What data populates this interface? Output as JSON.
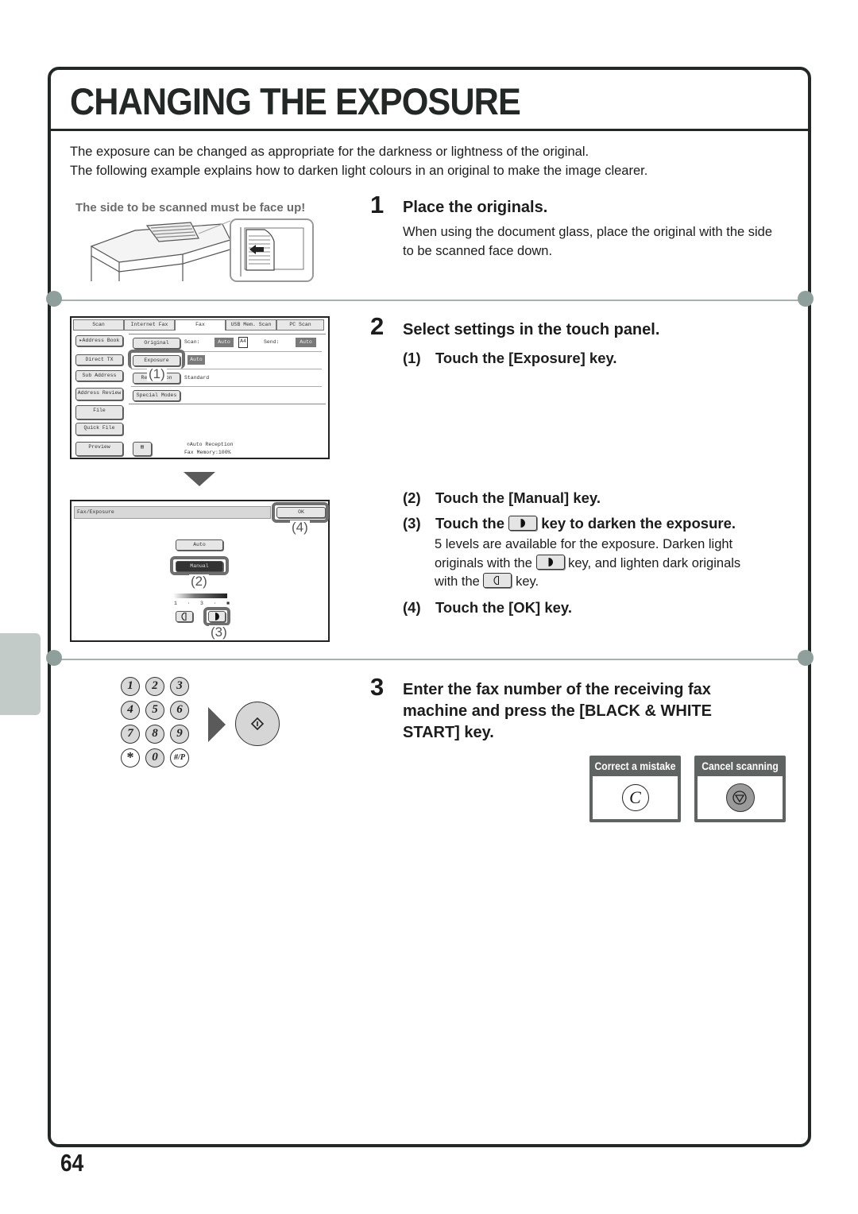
{
  "page": {
    "title": "CHANGING THE EXPOSURE",
    "intro_lines": [
      "The exposure can be changed as appropriate for the darkness or lightness of the original.",
      "The following example explains how to darken light colours in an original to make the image clearer."
    ],
    "page_number": "64"
  },
  "illustration_1": {
    "caption": "The side to be scanned must be face up!"
  },
  "steps": [
    {
      "number": "1",
      "title": "Place the originals.",
      "body": "When using the document glass, place the original with the side to be scanned face down."
    },
    {
      "number": "2",
      "title": "Select settings in the touch panel.",
      "substeps": [
        {
          "number": "(1)",
          "text": "Touch the [Exposure] key."
        },
        {
          "number": "(2)",
          "text": "Touch the [Manual] key."
        },
        {
          "number": "(3)",
          "text_before": "Touch the",
          "text_after": "key to darken the exposure.",
          "icon": "darker-key-icon",
          "note_line1": "5 levels are available for the exposure. Darken light",
          "note_line2_before": "originals with the",
          "note_line2_after": "key, and lighten dark originals",
          "note_line3_before": "with the",
          "note_line3_after": "key."
        },
        {
          "number": "(4)",
          "text": "Touch the [OK] key."
        }
      ]
    },
    {
      "number": "3",
      "title_lines": [
        "Enter the fax number of the receiving fax",
        "machine and press the [BLACK & WHITE",
        "START] key."
      ]
    }
  ],
  "touch_panel_1": {
    "tabs": [
      "Scan",
      "Internet Fax",
      "Fax",
      "USB Mem. Scan",
      "PC Scan"
    ],
    "active_tab": "Fax",
    "left_buttons": [
      "Address Book",
      "Direct TX",
      "Sub Address",
      "Address Review",
      "File",
      "Quick File",
      "Preview"
    ],
    "rows": {
      "original_label": "Original",
      "scan_label": "Scan:",
      "scan_value": "Auto",
      "paper_size": "A4",
      "send_label": "Send:",
      "send_value": "Auto",
      "exposure_label": "Exposure",
      "exposure_value": "Auto",
      "resolution_label": "Resolution",
      "resolution_value": "Standard",
      "special_modes_label": "Special Modes"
    },
    "status_line1": "Auto Reception",
    "status_line2": "Fax Memory:100%",
    "callout": "(1)"
  },
  "touch_panel_2": {
    "header": "Fax/Exposure",
    "ok_label": "OK",
    "auto_label": "Auto",
    "manual_label": "Manual",
    "scale_labels": [
      "1",
      "·",
      "3",
      "·",
      "■"
    ],
    "exposure_level": "5 of 5",
    "callouts": [
      "(2)",
      "(3)",
      "(4)"
    ]
  },
  "keypad": {
    "keys": [
      "1",
      "2",
      "3",
      "4",
      "5",
      "6",
      "7",
      "8",
      "9",
      "*",
      "0",
      "#/P"
    ]
  },
  "key_cards": [
    {
      "label": "Correct a mistake",
      "key_glyph": "C"
    },
    {
      "label": "Cancel scanning",
      "key_glyph": "stop"
    }
  ],
  "colors": {
    "frame": "#232826",
    "side_tab": "#c3cbc8",
    "divider_knob": "#8fa09c",
    "key_card": "#5f6361"
  }
}
